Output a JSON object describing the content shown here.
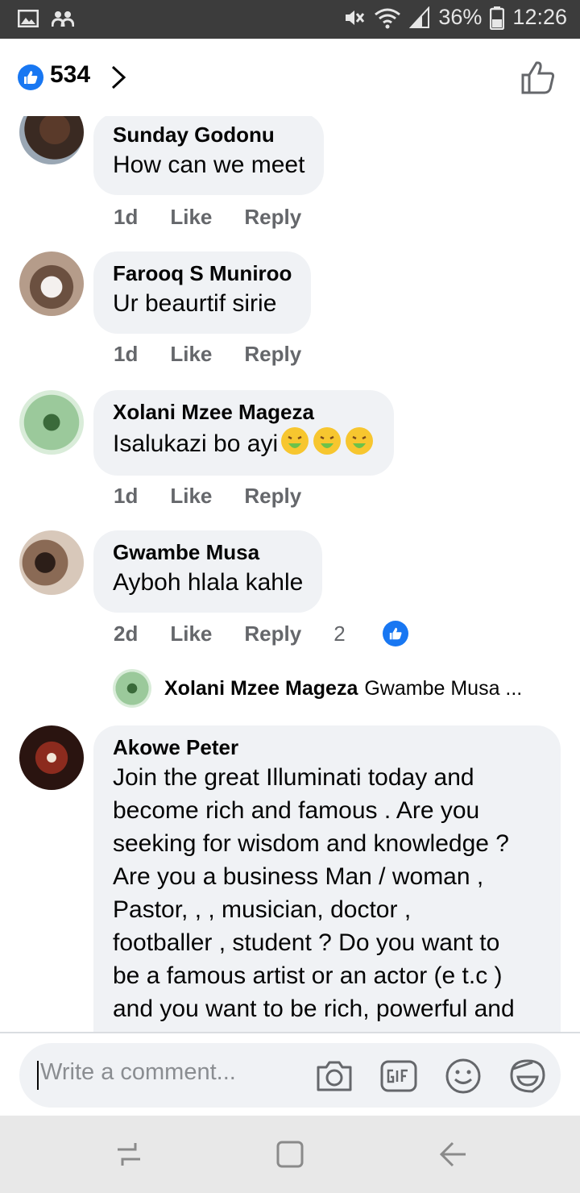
{
  "status_bar": {
    "battery": "36%",
    "time": "12:26"
  },
  "header": {
    "like_count": "534"
  },
  "comments": [
    {
      "author": "Sunday Godonu",
      "text": "How can we meet",
      "time": "1d",
      "like_label": "Like",
      "reply_label": "Reply"
    },
    {
      "author": "Farooq S Muniroo",
      "text": "Ur beaurtif  sirie",
      "time": "1d",
      "like_label": "Like",
      "reply_label": "Reply"
    },
    {
      "author": "Xolani Mzee Mageza",
      "text": "Isalukazi bo ayi",
      "emoji_count": 3,
      "time": "1d",
      "like_label": "Like",
      "reply_label": "Reply"
    },
    {
      "author": "Gwambe Musa",
      "text": "Ayboh hlala kahle",
      "time": "2d",
      "like_label": "Like",
      "reply_label": "Reply",
      "reaction_count": "2",
      "reply_preview": {
        "author": "Xolani Mzee Mageza",
        "snippet": "Gwambe Musa ..."
      }
    },
    {
      "author": "Akowe Peter",
      "lines": [
        "Join the great Illuminati today and",
        "become rich and famous . Are you",
        "seeking for wisdom and knowledge ?",
        "Are you a business Man / woman ,",
        "Pastor, , , musician, doctor ,",
        "footballer , student ? Do you want to",
        "be a famous artist or an actor (e t.c )",
        "and you want to be rich, powerful and"
      ]
    }
  ],
  "composer": {
    "placeholder": "Write a comment..."
  },
  "icons": {
    "header": [
      "like-badge-icon",
      "chevron-right-icon",
      "thumbs-up-outline-icon"
    ],
    "composer": [
      "camera-icon",
      "gif-icon",
      "emoji-icon",
      "sticker-icon"
    ],
    "nav": [
      "recent-apps-icon",
      "home-icon",
      "back-icon"
    ]
  },
  "colors": {
    "accent": "#1877f2",
    "bubble": "#f0f2f5",
    "secondary_text": "#65676b",
    "status_bar": "#3c3c3c"
  }
}
